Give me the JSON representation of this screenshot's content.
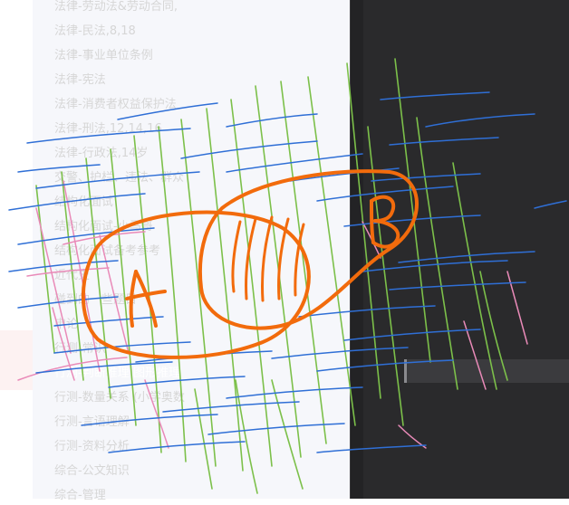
{
  "sidebar": {
    "items": [
      {
        "label": "法律-劳动法&劳动合同,"
      },
      {
        "label": "法律-民法,8,18"
      },
      {
        "label": "法律-事业单位条例"
      },
      {
        "label": "法律-宪法"
      },
      {
        "label": "法律-消费者权益保护法"
      },
      {
        "label": "法律-刑法,12,14,16"
      },
      {
        "label": "法律-行政法,14岁"
      },
      {
        "label": "交警、护栏、违法、群众"
      },
      {
        "label": "结构化面试"
      },
      {
        "label": "结构化面试-小马哥"
      },
      {
        "label": "结构化面试备考参考"
      },
      {
        "label": "近代史"
      },
      {
        "label": "碰到的一些题目"
      },
      {
        "label": "申论"
      },
      {
        "label": "行测-常识"
      },
      {
        "label": "行测-判断推理:图形推理"
      },
      {
        "label": "行测-数量关系 (小学奥数"
      },
      {
        "label": "行测-言语理解"
      },
      {
        "label": "行测-资料分析"
      },
      {
        "label": "综合-公文知识"
      },
      {
        "label": "综合-管理"
      }
    ],
    "active_index": 15
  },
  "drawing": {
    "labels": [
      "A",
      "B"
    ],
    "colors": {
      "orange": "#f26b0c",
      "green": "#7cc04a",
      "blue": "#2f6fd6",
      "pink": "#e98ab8"
    }
  }
}
